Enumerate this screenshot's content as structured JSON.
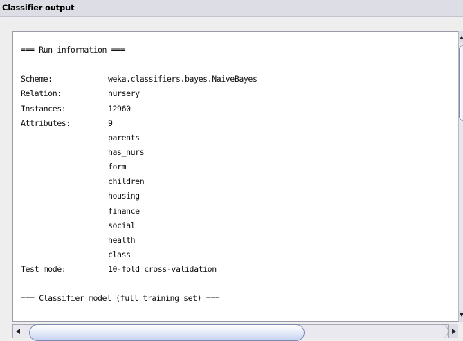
{
  "panel": {
    "title": "Classifier output"
  },
  "output": {
    "header": "=== Run information ===",
    "rows": [
      {
        "key": "Scheme:",
        "value": "weka.classifiers.bayes.NaiveBayes"
      },
      {
        "key": "Relation:",
        "value": "nursery"
      },
      {
        "key": "Instances:",
        "value": "12960"
      },
      {
        "key": "Attributes:",
        "value": "9"
      }
    ],
    "attributes": [
      "parents",
      "has_nurs",
      "form",
      "children",
      "housing",
      "finance",
      "social",
      "health",
      "class"
    ],
    "test_mode": {
      "key": "Test mode:",
      "value": "10-fold cross-validation"
    },
    "model_header": "=== Classifier model (full training set) ==="
  },
  "colors": {
    "title_bar": "#dddde6",
    "background": "#eeeeee",
    "text_area": "#ffffff",
    "scroll_thumb": "#c9d6f2"
  },
  "icons": {
    "scroll_up": "arrow-up-icon",
    "scroll_down": "arrow-down-icon",
    "scroll_left": "arrow-left-icon",
    "scroll_right": "arrow-right-icon"
  }
}
